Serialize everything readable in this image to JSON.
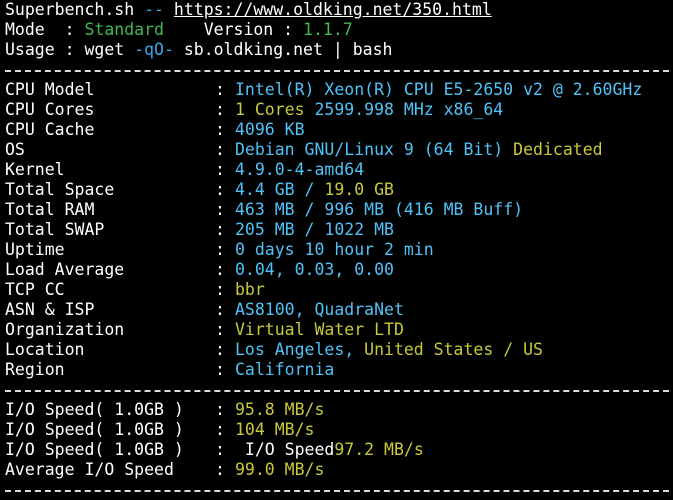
{
  "header": {
    "line1": {
      "name": "Superbench.sh",
      "sep": " -- ",
      "url": "https://www.oldking.net/350.html"
    },
    "line2": {
      "label": "Mode  : ",
      "mode": "Standard",
      "gap": "    Version : ",
      "version": "1.1.7"
    },
    "line3": {
      "label": "Usage : wget ",
      "flag": "-qO-",
      "rest": " sb.oldking.net | bash"
    }
  },
  "sysinfo": [
    {
      "key": "CPU Model",
      "parts": [
        {
          "t": "Intel(R) Xeon(R) CPU E5-2650 v2 @ 2.60GHz",
          "c": "cyan"
        }
      ]
    },
    {
      "key": "CPU Cores",
      "parts": [
        {
          "t": "1 Cores ",
          "c": "yellow"
        },
        {
          "t": "2599.998 MHz x86_64",
          "c": "cyan"
        }
      ]
    },
    {
      "key": "CPU Cache",
      "parts": [
        {
          "t": "4096 KB",
          "c": "cyan"
        }
      ]
    },
    {
      "key": "OS",
      "parts": [
        {
          "t": "Debian GNU/Linux 9 (64 Bit) ",
          "c": "cyan"
        },
        {
          "t": "Dedicated",
          "c": "yellow"
        }
      ]
    },
    {
      "key": "Kernel",
      "parts": [
        {
          "t": "4.9.0-4-amd64",
          "c": "cyan"
        }
      ]
    },
    {
      "key": "Total Space",
      "parts": [
        {
          "t": "4.4 GB / ",
          "c": "cyan"
        },
        {
          "t": "19.0 GB",
          "c": "yellow"
        }
      ]
    },
    {
      "key": "Total RAM",
      "parts": [
        {
          "t": "463 MB / 996 MB (416 MB Buff)",
          "c": "cyan"
        }
      ]
    },
    {
      "key": "Total SWAP",
      "parts": [
        {
          "t": "205 MB / 1022 MB",
          "c": "cyan"
        }
      ]
    },
    {
      "key": "Uptime",
      "parts": [
        {
          "t": "0 days 10 hour 2 min",
          "c": "cyan"
        }
      ]
    },
    {
      "key": "Load Average",
      "parts": [
        {
          "t": "0.04, 0.03, 0.00",
          "c": "cyan"
        }
      ]
    },
    {
      "key": "TCP CC",
      "parts": [
        {
          "t": "bbr",
          "c": "yellow"
        }
      ]
    },
    {
      "key": "ASN & ISP",
      "parts": [
        {
          "t": "AS8100, QuadraNet",
          "c": "cyan"
        }
      ]
    },
    {
      "key": "Organization",
      "parts": [
        {
          "t": "Virtual Water LTD",
          "c": "yellow"
        }
      ]
    },
    {
      "key": "Location",
      "parts": [
        {
          "t": "Los Angeles, ",
          "c": "cyan"
        },
        {
          "t": "United States / US",
          "c": "yellow"
        }
      ]
    },
    {
      "key": "Region",
      "parts": [
        {
          "t": "California",
          "c": "cyan"
        }
      ]
    }
  ],
  "io": [
    {
      "key": "I/O Speed( 1.0GB )",
      "parts": [
        {
          "t": "95.8 MB/s",
          "c": "yellow"
        }
      ]
    },
    {
      "key": "I/O Speed( 1.0GB )",
      "parts": [
        {
          "t": "104 MB/s",
          "c": "yellow"
        }
      ]
    },
    {
      "key": "I/O Speed( 1.0GB )",
      "parts": [
        {
          "t": " I/O Speed",
          "c": "white"
        },
        {
          "t": "97.2 MB/s",
          "c": "yellow"
        }
      ]
    },
    {
      "key": "Average I/O Speed",
      "parts": [
        {
          "t": "99.0 MB/s",
          "c": "yellow"
        }
      ]
    }
  ],
  "colon": ":"
}
